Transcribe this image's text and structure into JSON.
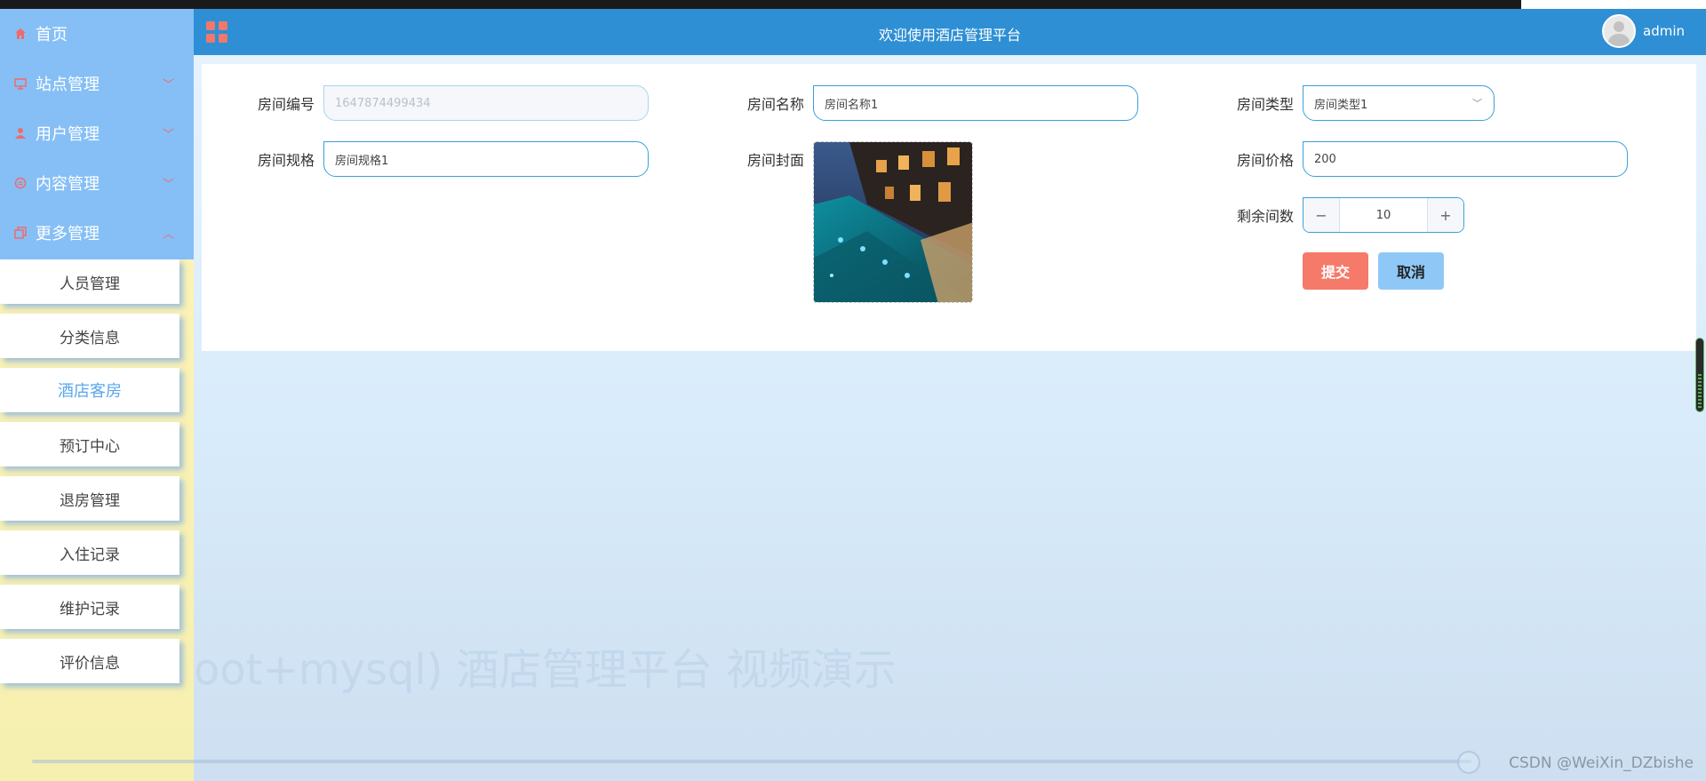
{
  "header": {
    "title": "欢迎使用酒店管理平台",
    "username": "admin"
  },
  "sidebar": {
    "items": [
      {
        "label": "首页",
        "icon": "home-icon"
      },
      {
        "label": "站点管理",
        "icon": "monitor-icon"
      },
      {
        "label": "用户管理",
        "icon": "user-icon"
      },
      {
        "label": "内容管理",
        "icon": "chat-icon"
      },
      {
        "label": "更多管理",
        "icon": "copy-icon"
      }
    ],
    "submenu": [
      "人员管理",
      "分类信息",
      "酒店客房",
      "预订中心",
      "退房管理",
      "入住记录",
      "维护记录",
      "评价信息"
    ],
    "active_submenu": "酒店客房"
  },
  "form": {
    "room_no": {
      "label": "房间编号",
      "value": "1647874499434"
    },
    "room_name": {
      "label": "房间名称",
      "value": "房间名称1"
    },
    "room_type": {
      "label": "房间类型",
      "value": "房间类型1"
    },
    "room_spec": {
      "label": "房间规格",
      "value": "房间规格1"
    },
    "room_cover": {
      "label": "房间封面"
    },
    "room_price": {
      "label": "房间价格",
      "value": "200"
    },
    "remaining": {
      "label": "剩余间数",
      "value": "10"
    },
    "submit_label": "提交",
    "cancel_label": "取消"
  },
  "overlay": {
    "watermark": "oot+mysql) 酒店管理平台 视频演示",
    "credit": "CSDN @WeiXin_DZbishe"
  },
  "colors": {
    "header": "#2e8fd4",
    "sidebar": "#86bff6",
    "accent_red": "#f57a6a",
    "accent_blue": "#8fc8f7"
  }
}
